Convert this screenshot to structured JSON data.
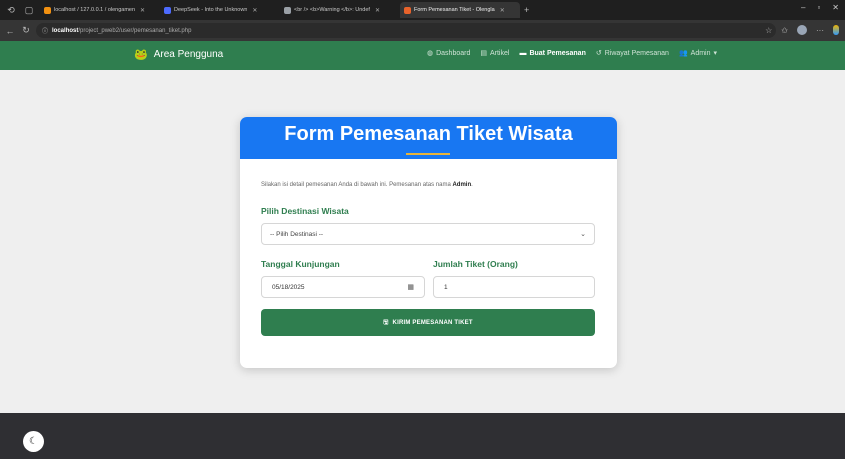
{
  "browser": {
    "tabs": [
      {
        "label": "localhost / 127.0.0.1 / olengamen",
        "icon": "phpmyadmin-icon",
        "color": "#f29111",
        "active": false
      },
      {
        "label": "DeepSeek - Into the Unknown",
        "icon": "deepseek-icon",
        "color": "#4d6bfe",
        "active": false
      },
      {
        "label": "<br /> <b>Warning </b>: Undef",
        "icon": "globe-icon",
        "color": "#9aa0a6",
        "active": false
      },
      {
        "label": "Form Pemesanan Tiket - Olengla",
        "icon": "page-icon",
        "color": "#e8632b",
        "active": true
      }
    ],
    "url_host": "localhost",
    "url_path": "/project_pweb2/user/pemesanan_tiket.php"
  },
  "navbar": {
    "brand": "Area Pengguna",
    "menu": [
      {
        "label": "Dashboard",
        "icon": "gauge-icon",
        "glyph": "◍",
        "active": false
      },
      {
        "label": "Artikel",
        "icon": "newspaper-icon",
        "glyph": "▤",
        "active": false
      },
      {
        "label": "Buat Pemesanan",
        "icon": "ticket-icon",
        "glyph": "▬",
        "active": true
      },
      {
        "label": "Riwayat Pemesanan",
        "icon": "history-icon",
        "glyph": "↺",
        "active": false
      },
      {
        "label": "Admin",
        "icon": "user-icon",
        "glyph": "👥",
        "active": false
      }
    ]
  },
  "form": {
    "title": "Form Pemesanan Tiket Wisata",
    "intro_prefix": "Silakan isi detail pemesanan Anda di bawah ini. Pemesanan atas nama ",
    "intro_name": "Admin",
    "intro_suffix": ".",
    "destination_label": "Pilih Destinasi Wisata",
    "destination_selected": "-- Pilih Destinasi --",
    "date_label": "Tanggal Kunjungan",
    "date_value": "05/18/2025",
    "qty_label": "Jumlah Tiket (Orang)",
    "qty_value": "1",
    "submit_label": "KIRIM PEMESANAN TIKET"
  },
  "colors": {
    "primary_green": "#2f7e4f",
    "header_blue": "#1877f2",
    "accent_gold": "#e7b43a"
  }
}
